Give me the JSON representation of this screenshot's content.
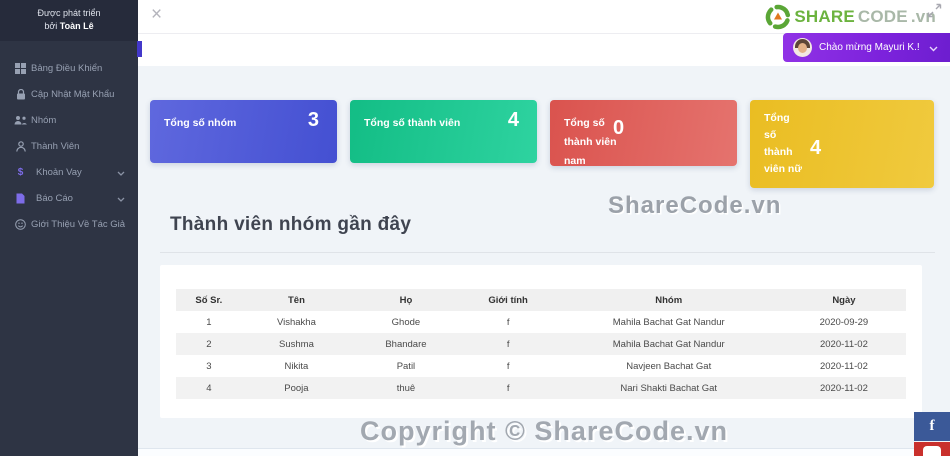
{
  "sidebar": {
    "dev_note": {
      "line1": "Được phát triển",
      "boi": "bởi ",
      "name": "Toàn Lê"
    },
    "items": [
      {
        "label": "Bảng Điều Khiển"
      },
      {
        "label": "Cập Nhật Mật Khẩu"
      },
      {
        "label": "Nhóm"
      },
      {
        "label": "Thành Viên"
      },
      {
        "label": "Khoản Vay"
      },
      {
        "label": "Báo Cáo"
      },
      {
        "label": "Giới Thiệu Về Tác Giả"
      }
    ]
  },
  "header": {
    "close_glyph": "×",
    "brand": {
      "share": "SHARE",
      "code": "CODE",
      "vn": ".vn"
    },
    "user_button_label": "Chào mừng Mayuri K.!"
  },
  "stats": [
    {
      "label": "Tổng số nhóm",
      "value": "3",
      "color": "#4f5bd5"
    },
    {
      "label": "Tổng số thành viên",
      "value": "4",
      "color": "#1fc998"
    },
    {
      "label": "Tổng số thành viên nam",
      "value": "0",
      "color": "#dd5c57"
    },
    {
      "label": "Tổng số thành viên nữ",
      "value": "4",
      "color": "#eec236"
    }
  ],
  "section": {
    "title": "Thành viên nhóm gần đây"
  },
  "table": {
    "headers": [
      "Số Sr.",
      "Tên",
      "Họ",
      "Giới tính",
      "Nhóm",
      "Ngày"
    ],
    "rows": [
      [
        "1",
        "Vishakha",
        "Ghode",
        "f",
        "Mahila Bachat Gat Nandur",
        "2020-09-29"
      ],
      [
        "2",
        "Sushma",
        "Bhandare",
        "f",
        "Mahila Bachat Gat Nandur",
        "2020-11-02"
      ],
      [
        "3",
        "Nikita",
        "Patil",
        "f",
        "Navjeen Bachat Gat",
        "2020-11-02"
      ],
      [
        "4",
        "Pooja",
        "thuê",
        "f",
        "Nari Shakti Bachat Gat",
        "2020-11-02"
      ]
    ]
  },
  "watermarks": {
    "center": "ShareCode.vn",
    "bottom": "Copyright © ShareCode.vn"
  },
  "social": {
    "facebook_glyph": "f"
  },
  "colors": {
    "sidebar_bg": "#2e3444",
    "main_bg": "#f0f4f8",
    "accent_purple": "#7c22dc",
    "active_indicator": "#4338ca",
    "brand_green": "#6cb33f",
    "facebook_blue": "#3b5998",
    "youtube_red": "#c9302c"
  }
}
